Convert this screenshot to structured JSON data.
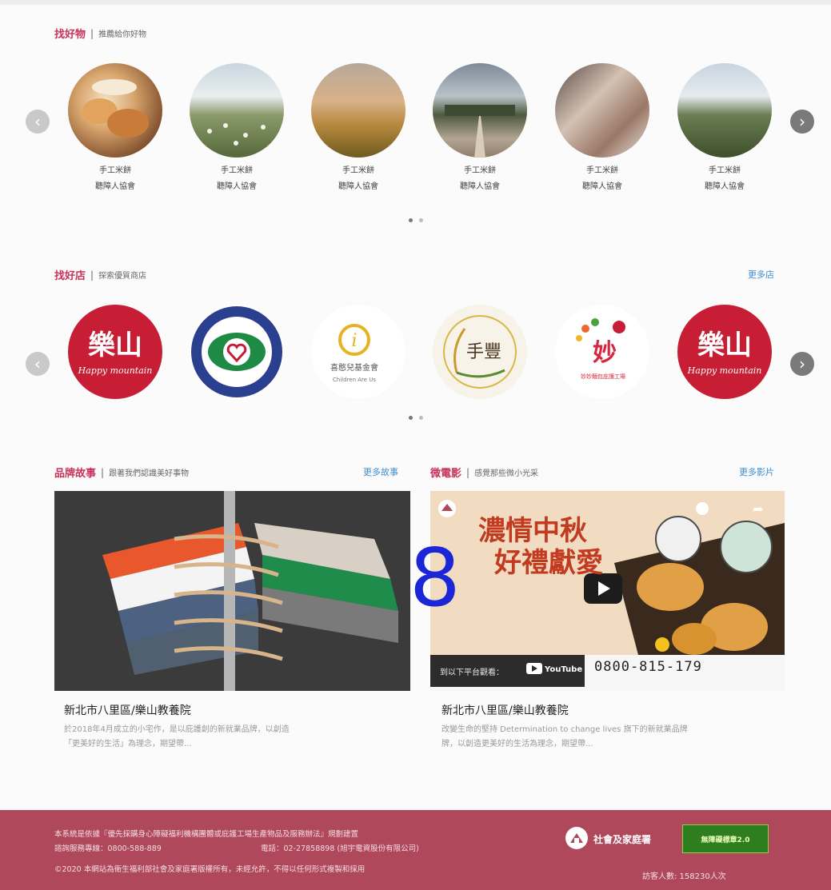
{
  "goods": {
    "title": "找好物",
    "subtitle": "推薦給你好物",
    "items": [
      {
        "name": "手工米餅",
        "org": "聽障人協會"
      },
      {
        "name": "手工米餅",
        "org": "聽障人協會"
      },
      {
        "name": "手工米餅",
        "org": "聽障人協會"
      },
      {
        "name": "手工米餅",
        "org": "聽障人協會"
      },
      {
        "name": "手工米餅",
        "org": "聽障人協會"
      },
      {
        "name": "手工米餅",
        "org": "聽障人協會"
      }
    ]
  },
  "shops": {
    "title": "找好店",
    "subtitle": "探索優質商店",
    "more": "更多店",
    "logos": {
      "logo1": "Happy mountain",
      "logo4": "手豐",
      "logo3_name": "喜憨兒基金會",
      "logo3_en": "Children Are Us",
      "logo5_name": "妙妙麵包庇護工場",
      "logo6": "Happy mountain"
    }
  },
  "stories": {
    "title": "品牌故事",
    "subtitle": "跟著我們認識美好事物",
    "more": "更多故事",
    "card_title": "新北市八里區/樂山教養院",
    "desc1": "於2018年4月成立的小宅作，是以庇護創的新就業品牌，以創造",
    "desc2": "「更美好的生活」為理念，期望帶..."
  },
  "films": {
    "title": "微電影",
    "subtitle": "感覺那些微小光采",
    "more": "更多影片",
    "card_title": "新北市八里區/樂山教養院",
    "desc1": "改變生命的堅持 Determination to change lives 旗下的新就業品牌",
    "desc2": "牌，以創造更美好的生活為理念，期望帶...",
    "video_headline1": "濃情中秋",
    "video_headline2": "好禮獻愛",
    "watch_on": "到以下平台觀看：",
    "youtube": "YouTube",
    "phone": "0800-815-179"
  },
  "overlay_number": "8",
  "footer": {
    "line1": "本系統是依據『優先採購身心障礙福利機構團體或庇護工場生產物品及服務辦法』規劃建置",
    "service": "諮詢服務專線：0800-588-889",
    "tel": "電話：02-27858898 (旭宇電資股份有限公司)",
    "copyright": "©2020 本網站為衛生福利部社會及家庭署版權所有，未經允許，不得以任何形式複製和採用",
    "agency": "社會及家庭署",
    "badge": "無障礙標章2.0",
    "visitors": "訪客人數: 158230人次"
  }
}
